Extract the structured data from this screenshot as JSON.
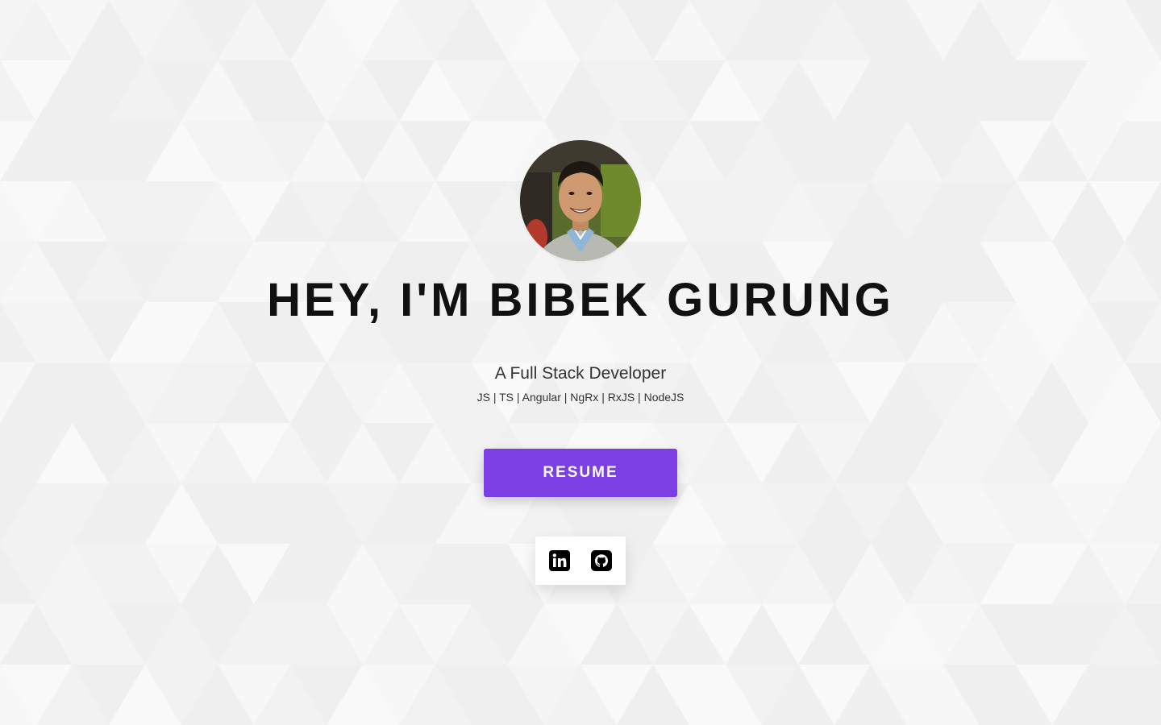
{
  "hero": {
    "headline": "HEY, I'M BIBEK GURUNG",
    "subtitle": "A Full Stack Developer",
    "skills": "JS | TS | Angular | NgRx | RxJS | NodeJS",
    "resume_label": "RESUME"
  },
  "social": [
    {
      "icon": "linkedin-icon"
    },
    {
      "icon": "github-icon"
    }
  ],
  "colors": {
    "accent": "#7b3fe4",
    "background": "#f5f5f5",
    "text": "#111111"
  }
}
